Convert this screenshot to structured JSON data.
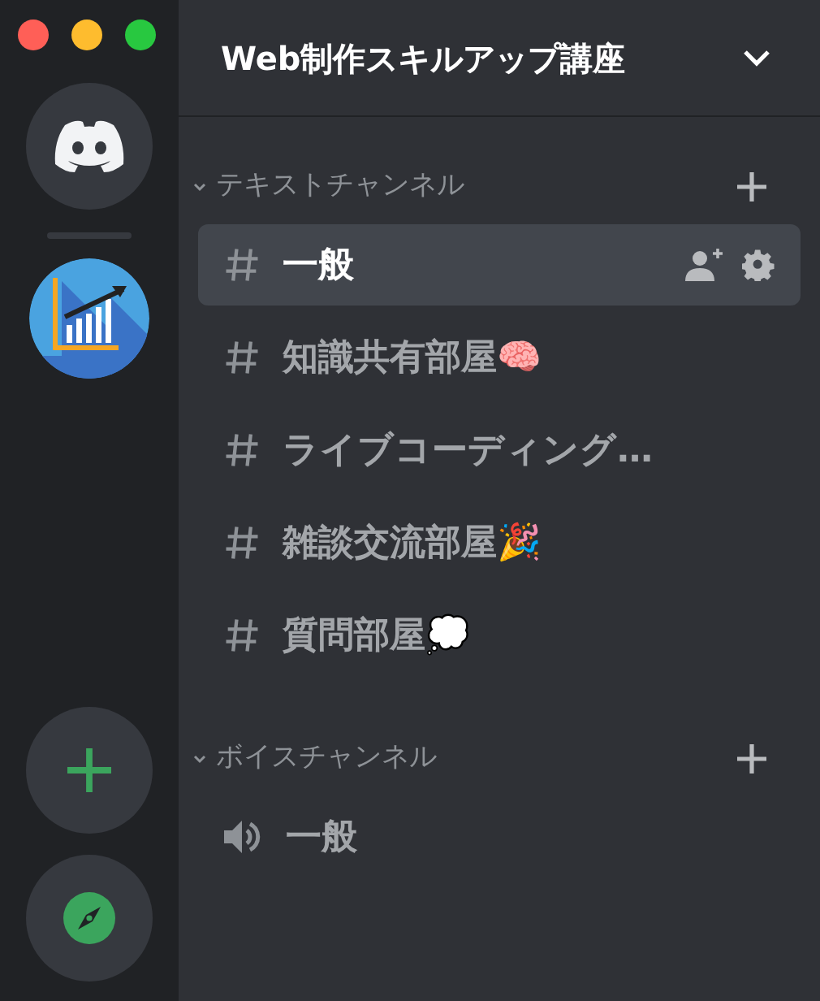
{
  "window_controls": [
    {
      "color": "#ff5f57"
    },
    {
      "color": "#febc2e"
    },
    {
      "color": "#28c840"
    }
  ],
  "servers": [
    {
      "kind": "home",
      "selected": false
    },
    {
      "kind": "server",
      "selected": true
    }
  ],
  "server_actions": [
    {
      "kind": "add"
    },
    {
      "kind": "explore"
    }
  ],
  "header": {
    "title": "Web制作スキルアップ講座"
  },
  "categories": [
    {
      "name": "テキストチャンネル",
      "expanded": true,
      "channels": [
        {
          "kind": "text",
          "name": "一般",
          "selected": true
        },
        {
          "kind": "text",
          "name": "知識共有部屋🧠",
          "selected": false
        },
        {
          "kind": "text",
          "name": "ライブコーディング…",
          "selected": false
        },
        {
          "kind": "text",
          "name": "雑談交流部屋🎉",
          "selected": false
        },
        {
          "kind": "text",
          "name": "質問部屋💭",
          "selected": false
        }
      ]
    },
    {
      "name": "ボイスチャンネル",
      "expanded": true,
      "channels": [
        {
          "kind": "voice",
          "name": "一般",
          "selected": false
        }
      ]
    }
  ]
}
